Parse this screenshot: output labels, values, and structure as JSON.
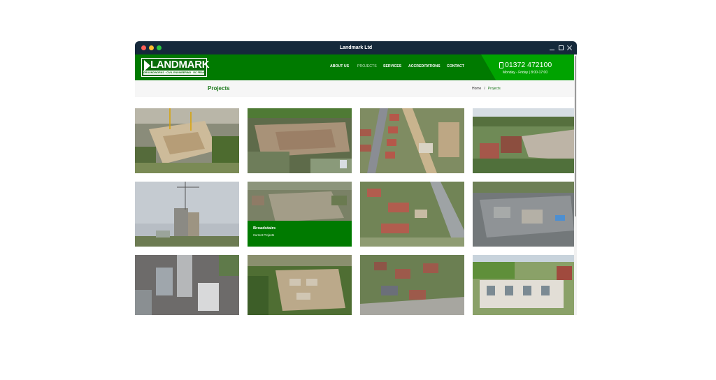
{
  "window": {
    "title": "Landmark Ltd"
  },
  "logo": {
    "word": "LANDMARK",
    "tagline": "GROUNDWORKS · CIVIL ENGINEERING · RC FRAMES"
  },
  "nav": {
    "items": [
      "ABOUT US",
      "PROJECTS",
      "SERVICES",
      "ACCREDITATIONS",
      "CONTACT"
    ],
    "active": "PROJECTS"
  },
  "contact": {
    "phone": "01372 472100",
    "hours": "Monday - Friday | 8:00-17:00",
    "icon": "phone-icon"
  },
  "page": {
    "title": "Projects"
  },
  "breadcrumb": {
    "home": "Home",
    "separator": "/",
    "current": "Projects"
  },
  "projects": {
    "hovered": {
      "title": "Broadstairs",
      "subtitle": "Current Projects"
    }
  },
  "colors": {
    "brand_green": "#007a00",
    "accent_green": "#00a300",
    "titlebar": "#15293b"
  }
}
